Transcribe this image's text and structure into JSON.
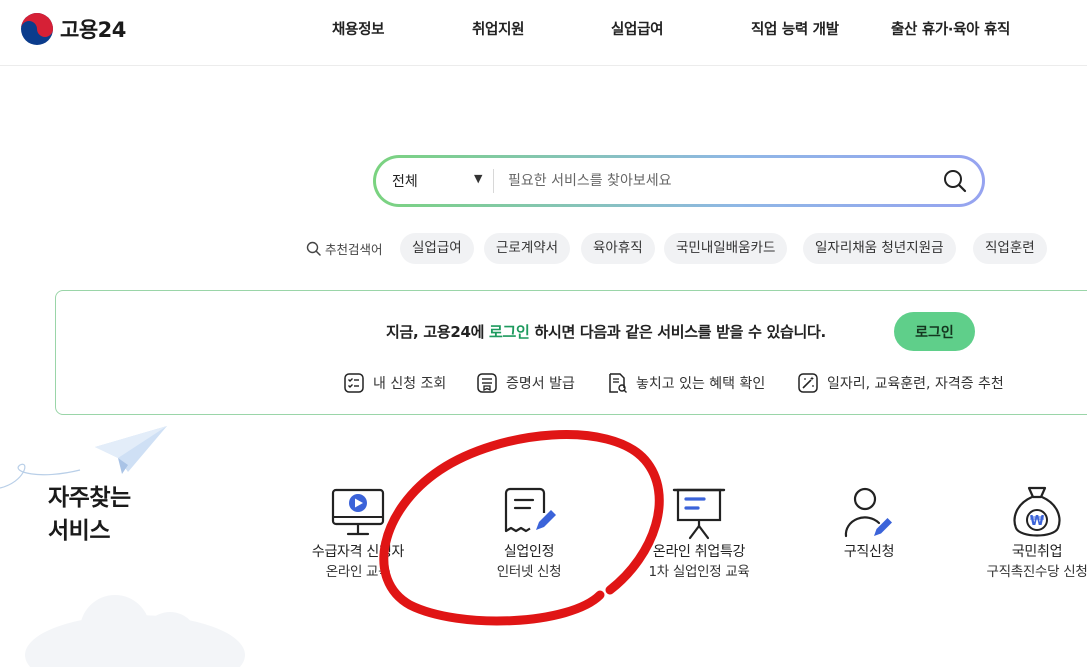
{
  "header": {
    "logo_text": "고용24",
    "nav": [
      "채용정보",
      "취업지원",
      "실업급여",
      "직업 능력 개발",
      "출산 휴가·육아 휴직"
    ]
  },
  "search": {
    "scope": "전체",
    "placeholder": "필요한 서비스를 찾아보세요",
    "value": ""
  },
  "recommended": {
    "label": "추천검색어",
    "tags": [
      "실업급여",
      "근로계약서",
      "육아휴직",
      "국민내일배움카드",
      "일자리채움 청년지원금",
      "직업훈련"
    ]
  },
  "login_box": {
    "msg_before": "지금, 고용24에 ",
    "msg_highlight": "로그인",
    "msg_after": " 하시면 다음과 같은 서비스를 받을 수 있습니다.",
    "button": "로그인",
    "services": [
      "내 신청 조회",
      "증명서 발급",
      "놓치고 있는 혜택 확인",
      "일자리, 교육훈련, 자격증 추천"
    ]
  },
  "frequent": {
    "title_line1": "자주찾는",
    "title_line2": "서비스",
    "items": [
      {
        "line1": "수급자격 신청자",
        "line2": "온라인 교육"
      },
      {
        "line1": "실업인정",
        "line2": "인터넷 신청"
      },
      {
        "line1": "온라인 취업특강",
        "line2": "1차 실업인정 교육"
      },
      {
        "line1": "구직신청",
        "line2": ""
      },
      {
        "line1": "국민취업",
        "line2": "구직촉진수당 신청"
      }
    ]
  },
  "colors": {
    "accent_green": "#5fcf8a",
    "highlight_green": "#1e9a5e",
    "icon_blue": "#3b63d9",
    "annotation_red": "#e01515"
  }
}
